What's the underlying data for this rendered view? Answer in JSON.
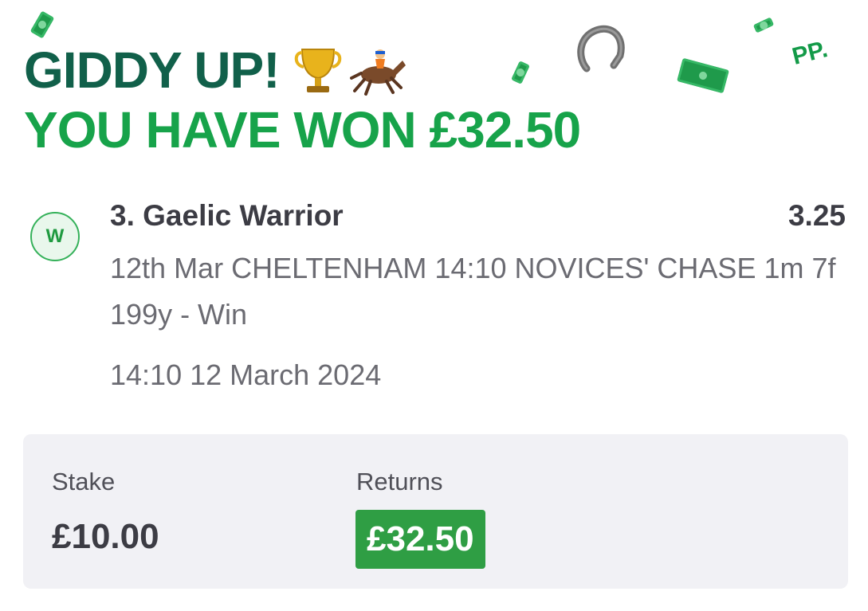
{
  "headline": {
    "line1": "GIDDY UP!",
    "line1_emojis": [
      "🏆",
      "🏇"
    ],
    "line2": "YOU HAVE WON £32.50"
  },
  "decorations": {
    "brand_mark": "PP.",
    "icons": [
      "money-icon",
      "horseshoe-icon",
      "trophy-icon",
      "horse-racing-icon"
    ]
  },
  "bet": {
    "result_badge": "W",
    "selection": "3. Gaelic Warrior",
    "odds": "3.25",
    "event_description": "12th Mar CHELTENHAM 14:10 NOVICES' CHASE 1m 7f 199y - Win",
    "event_time": "14:10 12 March 2024"
  },
  "summary": {
    "stake_label": "Stake",
    "stake_value": "£10.00",
    "returns_label": "Returns",
    "returns_value": "£32.50"
  },
  "colors": {
    "headline_dark_green": "#11604a",
    "headline_green": "#17a34a",
    "returns_badge": "#2f9e44",
    "panel_background": "#f1f1f5",
    "text_dark": "#3c3c44",
    "text_muted": "#6b6b72"
  }
}
